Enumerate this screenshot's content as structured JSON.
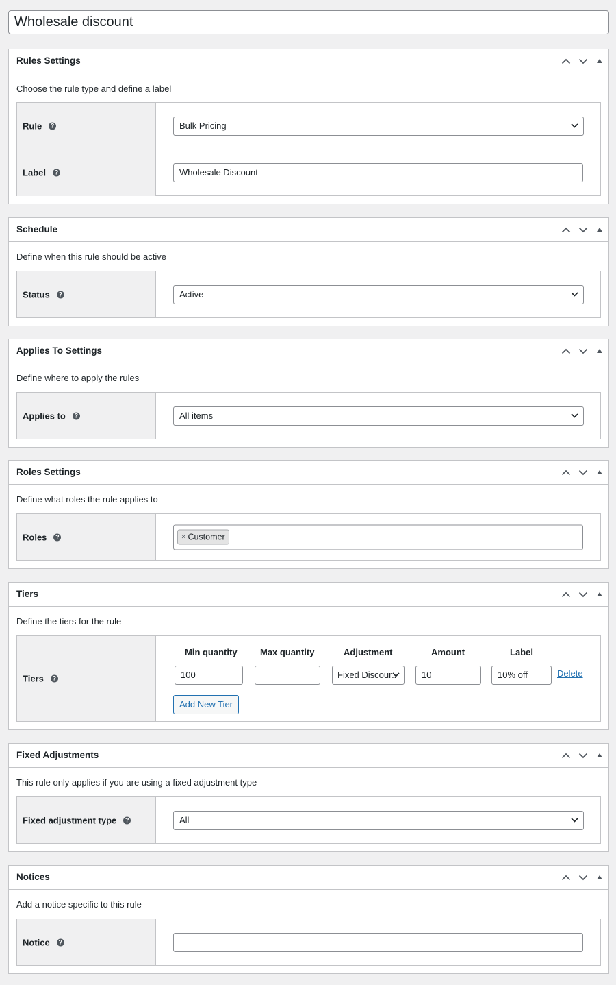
{
  "post_title": "Wholesale discount",
  "boxes": {
    "rules": {
      "title": "Rules Settings",
      "description": "Choose the rule type and define a label",
      "rule_label": "Rule",
      "rule_value": "Bulk Pricing",
      "label_label": "Label",
      "label_value": "Wholesale Discount"
    },
    "schedule": {
      "title": "Schedule",
      "description": "Define when this rule should be active",
      "status_label": "Status",
      "status_value": "Active"
    },
    "applies": {
      "title": "Applies To Settings",
      "description": "Define where to apply the rules",
      "applies_label": "Applies to",
      "applies_value": "All items"
    },
    "roles": {
      "title": "Roles Settings",
      "description": "Define what roles the rule applies to",
      "roles_label": "Roles",
      "chip_remove": "×",
      "chip_value": "Customer"
    },
    "tiers": {
      "title": "Tiers",
      "description": "Define the tiers for the rule",
      "tiers_label": "Tiers",
      "columns": {
        "min": "Min quantity",
        "max": "Max quantity",
        "adjustment": "Adjustment",
        "amount": "Amount",
        "label": "Label"
      },
      "row": {
        "min": "100",
        "max": "",
        "adjustment": "Fixed Discount",
        "amount": "10",
        "label": "10% off"
      },
      "delete_label": "Delete",
      "add_button": "Add New Tier"
    },
    "fixed": {
      "title": "Fixed Adjustments",
      "description": "This rule only applies if you are using a fixed adjustment type",
      "type_label": "Fixed adjustment type",
      "type_value": "All"
    },
    "notices": {
      "title": "Notices",
      "description": "Add a notice specific to this rule",
      "notice_label": "Notice",
      "notice_value": ""
    }
  },
  "help_glyph": "?",
  "icons": {
    "move_up": "chevron-up-icon",
    "move_down": "chevron-down-icon",
    "toggle": "triangle-up-icon",
    "help": "help-icon",
    "select": "chevron-down-icon"
  }
}
